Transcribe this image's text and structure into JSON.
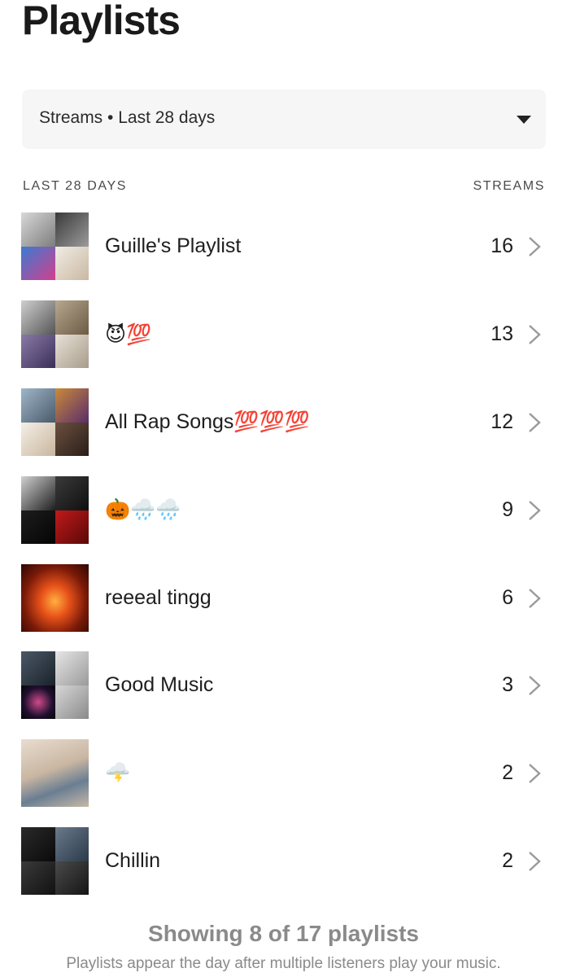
{
  "header": {
    "title": "Playlists"
  },
  "filter": {
    "label": "Streams • Last 28 days"
  },
  "columns": {
    "left": "LAST 28 DAYS",
    "right": "STREAMS"
  },
  "playlists": [
    {
      "name": "Guille's Playlist",
      "streams": "16"
    },
    {
      "name": "😈💯",
      "streams": "13"
    },
    {
      "name": "All Rap Songs💯💯💯",
      "streams": "12"
    },
    {
      "name": "🎃🌧️🌧️",
      "streams": "9"
    },
    {
      "name": "reeeal tingg",
      "streams": "6"
    },
    {
      "name": "Good Music",
      "streams": "3"
    },
    {
      "name": "🌩️",
      "streams": "2"
    },
    {
      "name": "Chillin",
      "streams": "2"
    }
  ],
  "footer": {
    "title": "Showing 8 of 17 playlists",
    "subtitle": "Playlists appear the day after multiple listeners play your music."
  }
}
